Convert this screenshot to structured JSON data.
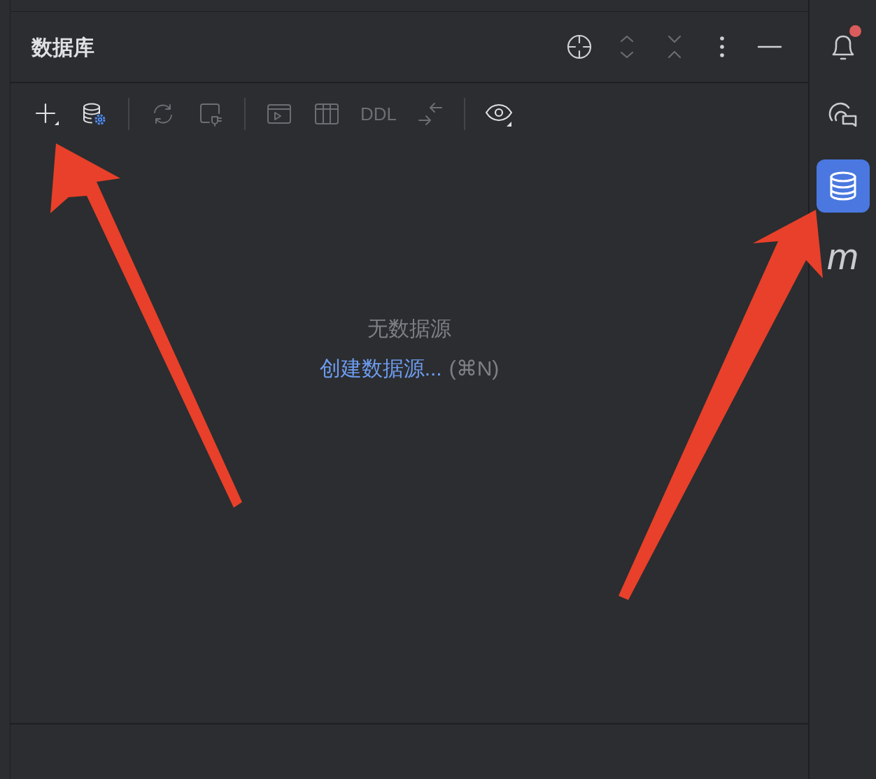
{
  "panel": {
    "title": "数据库"
  },
  "toolbar": [
    {
      "kind": "icon",
      "disabled": false
    },
    {
      "kind": "icon",
      "disabled": false
    },
    {
      "kind": "separator"
    },
    {
      "kind": "icon",
      "disabled": true
    },
    {
      "kind": "icon",
      "disabled": true
    },
    {
      "kind": "separator"
    },
    {
      "kind": "icon",
      "disabled": true
    },
    {
      "kind": "icon",
      "disabled": true
    },
    {
      "kind": "text",
      "label": "DDL",
      "disabled": true
    },
    {
      "kind": "icon",
      "disabled": true
    },
    {
      "kind": "separator"
    },
    {
      "kind": "icon",
      "disabled": false
    }
  ],
  "empty_state": {
    "message": "无数据源",
    "link": "创建数据源...",
    "shortcut": "(⌘N)"
  },
  "sidebar": {
    "items": [
      {
        "kind": "icon",
        "selected": false,
        "badge": true
      },
      {
        "kind": "icon",
        "selected": false,
        "badge": false
      },
      {
        "kind": "icon",
        "selected": true,
        "badge": false
      },
      {
        "kind": "letter",
        "label": "m",
        "selected": false,
        "badge": false
      }
    ]
  }
}
